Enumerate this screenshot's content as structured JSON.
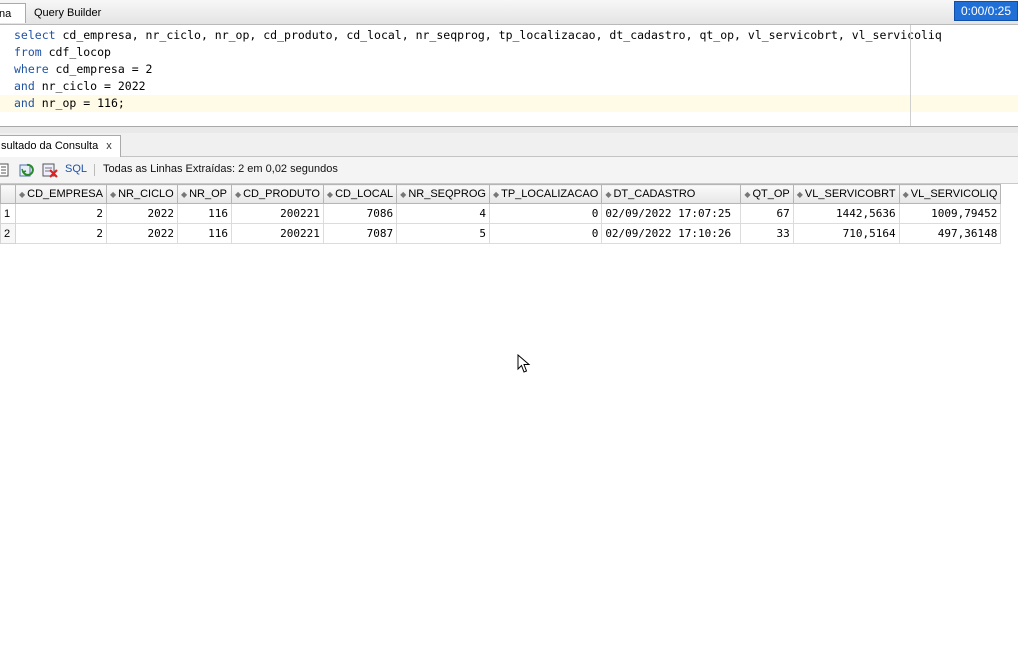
{
  "tabs": {
    "worksheet_label": "na",
    "query_builder_label": "Query Builder"
  },
  "timer": "0:00/0:25",
  "editor": {
    "lines": [
      {
        "kw": "select",
        "rest": " cd_empresa, nr_ciclo, nr_op, cd_produto, cd_local, nr_seqprog, tp_localizacao, dt_cadastro, qt_op, vl_servicobrt, vl_servicoliq"
      },
      {
        "kw": "from",
        "rest": " cdf_locop"
      },
      {
        "kw": "where",
        "rest": " cd_empresa = 2"
      },
      {
        "kw": "and",
        "rest": " nr_ciclo = 2022"
      },
      {
        "kw": "and",
        "rest": " nr_op = 116;"
      }
    ]
  },
  "result_tab": {
    "label": "sultado da Consulta",
    "close": "x"
  },
  "toolbar": {
    "sql_label": "SQL",
    "status": "Todas as Linhas Extraídas: 2 em 0,02 segundos"
  },
  "grid": {
    "columns": [
      "CD_EMPRESA",
      "NR_CICLO",
      "NR_OP",
      "CD_PRODUTO",
      "CD_LOCAL",
      "NR_SEQPROG",
      "TP_LOCALIZACAO",
      "DT_CADASTRO",
      "QT_OP",
      "VL_SERVICOBRT",
      "VL_SERVICOLIQ"
    ],
    "rows": [
      [
        "1",
        "2",
        "2022",
        "116",
        "200221",
        "7086",
        "4",
        "0",
        "02/09/2022 17:07:25",
        "67",
        "1442,5636",
        "1009,79452"
      ],
      [
        "2",
        "2",
        "2022",
        "116",
        "200221",
        "7087",
        "5",
        "0",
        "02/09/2022 17:10:26",
        "33",
        "710,5164",
        "497,36148"
      ]
    ]
  },
  "icons": {
    "toolbar": [
      "print-icon",
      "refresh-icon",
      "delete-icon"
    ],
    "cursor": "mouse-pointer-icon"
  },
  "colors": {
    "keyword": "#1f52a5",
    "timer_bg": "#1f6fd6",
    "current_line": "#fffbe6"
  }
}
